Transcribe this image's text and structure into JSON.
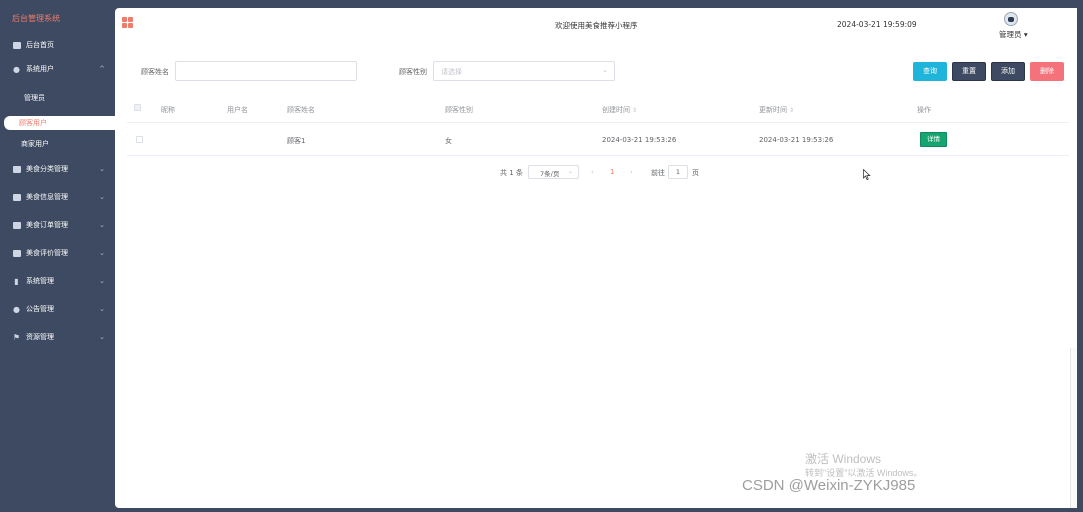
{
  "sidebar": {
    "brand": "后台管理系统",
    "home": "后台首页",
    "system_users": "系统用户",
    "sub_admin": "管理员",
    "sub_customer": "顾客用户",
    "sub_merchant": "商家用户",
    "items": [
      {
        "label": "美食分类管理"
      },
      {
        "label": "美食信息管理"
      },
      {
        "label": "美食订单管理"
      },
      {
        "label": "美食评价管理"
      },
      {
        "label": "系统管理"
      },
      {
        "label": "公告管理"
      },
      {
        "label": "资源管理"
      }
    ]
  },
  "header": {
    "welcome": "欢迎使用美食推荐小程序",
    "datetime": "2024-03-21 19:59:09",
    "user": "管理员"
  },
  "search": {
    "name_label": "顾客姓名",
    "name_value": "",
    "gender_label": "顾客性别",
    "gender_placeholder": "请选择",
    "query": "查询",
    "reset": "重置",
    "add": "添加",
    "delete": "删除"
  },
  "table": {
    "headers": [
      "昵称",
      "用户名",
      "顾客姓名",
      "顾客性别",
      "创建时间",
      "更新时间",
      "操作"
    ],
    "rows": [
      {
        "nickname": "",
        "username": "",
        "name": "顾客1",
        "gender": "女",
        "created": "2024-03-21 19:53:26",
        "updated": "2024-03-21 19:53:26",
        "action": "详情"
      }
    ]
  },
  "pagination": {
    "total": "共 1 条",
    "page_size": "7条/页",
    "current_page": "1",
    "goto_label": "前往",
    "goto_value": "1",
    "page_suffix": "页"
  },
  "watermark": {
    "activate_title": "激活 Windows",
    "activate_sub": "转到\"设置\"以激活 Windows。",
    "csdn": "CSDN @Weixin-ZYKJ985"
  },
  "colors": {
    "sidebar_bg": "#3d4a61",
    "accent": "#f07b6b",
    "query_btn": "#1fb4d9",
    "delete_btn": "#f4727a",
    "detail_btn": "#16a571"
  }
}
